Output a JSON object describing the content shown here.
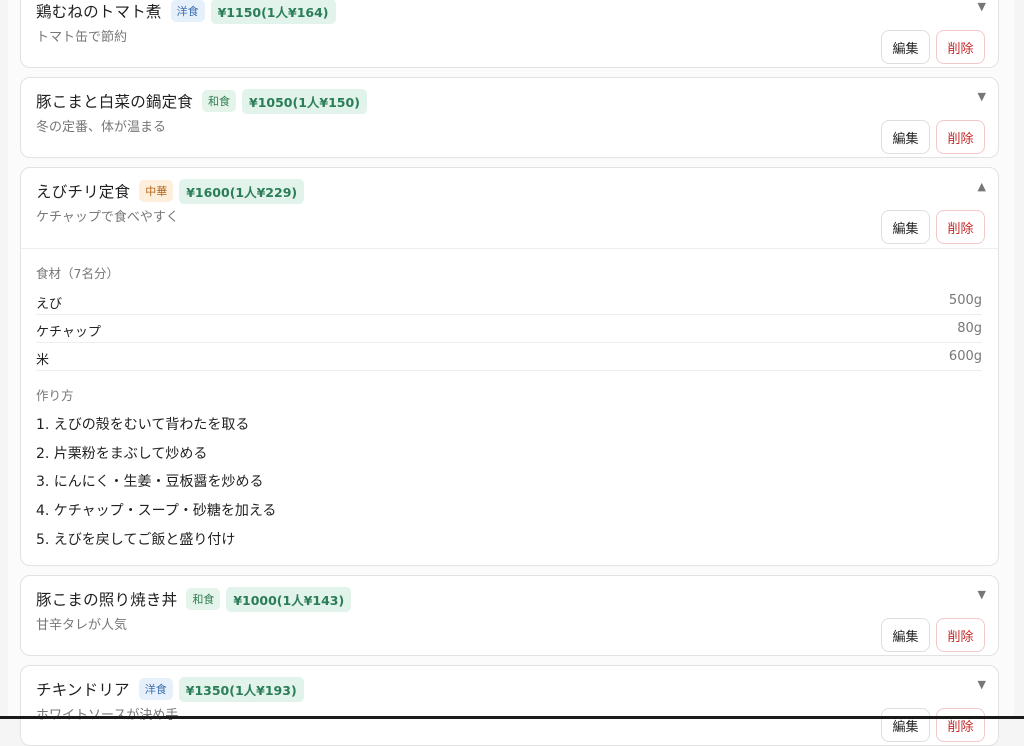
{
  "labels": {
    "edit": "編集",
    "delete": "削除",
    "chevron_collapsed": "▼",
    "chevron_expanded": "▲"
  },
  "recipes": [
    {
      "title": "鶏むねのトマト煮",
      "category": "洋食",
      "price": "¥1150(1人¥164)",
      "desc": "トマト缶で節約"
    },
    {
      "title": "豚こまと白菜の鍋定食",
      "category": "和食",
      "price": "¥1050(1人¥150)",
      "desc": "冬の定番、体が温まる"
    },
    {
      "title": "えびチリ定食",
      "category": "中華",
      "price": "¥1600(1人¥229)",
      "desc": "ケチャップで食べやすく",
      "ingredients_label": "食材（7名分）",
      "ingredients": [
        {
          "name": "えび",
          "qty": "500g"
        },
        {
          "name": "ケチャップ",
          "qty": "80g"
        },
        {
          "name": "米",
          "qty": "600g"
        }
      ],
      "steps_label": "作り方",
      "steps": [
        "1. えびの殻をむいて背わたを取る",
        "2. 片栗粉をまぶして炒める",
        "3. にんにく・生姜・豆板醤を炒める",
        "4. ケチャップ・スープ・砂糖を加える",
        "5. えびを戻してご飯と盛り付け"
      ]
    },
    {
      "title": "豚こまの照り焼き丼",
      "category": "和食",
      "price": "¥1000(1人¥143)",
      "desc": "甘辛タレが人気"
    },
    {
      "title": "チキンドリア",
      "category": "洋食",
      "price": "¥1350(1人¥193)",
      "desc": "ホワイトソースが決め手"
    }
  ]
}
